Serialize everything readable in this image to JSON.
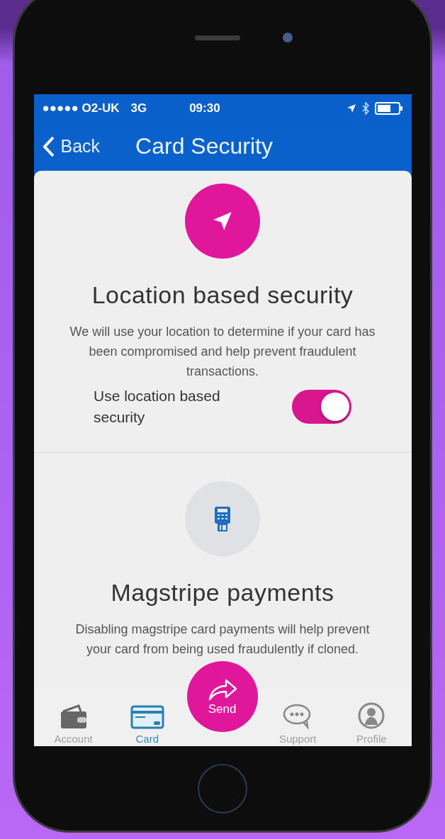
{
  "status_bar": {
    "carrier": "●●●●● O2-UK",
    "network": "3G",
    "time": "09:30"
  },
  "nav_bar": {
    "back": "Back",
    "title": "Card Security"
  },
  "sections": [
    {
      "kind": "location",
      "title": "Location based security",
      "description": "We will use your location to determine if your card has been compromised and help prevent fraudulent transactions.",
      "toggle": {
        "label": "Use location based security",
        "on": true
      }
    },
    {
      "kind": "terminal",
      "title": "Magstripe payments",
      "description": "Disabling magstripe card payments will help prevent your card from being used fraudulently if cloned."
    }
  ],
  "tab_bar": [
    {
      "kind": "wallet",
      "label": "Account",
      "selected": false
    },
    {
      "kind": "card",
      "label": "Card",
      "selected": true
    },
    {
      "kind": "send",
      "label": "Send"
    },
    {
      "kind": "chat",
      "label": "Support",
      "selected": false
    },
    {
      "kind": "person",
      "label": "Profile",
      "selected": false
    }
  ]
}
